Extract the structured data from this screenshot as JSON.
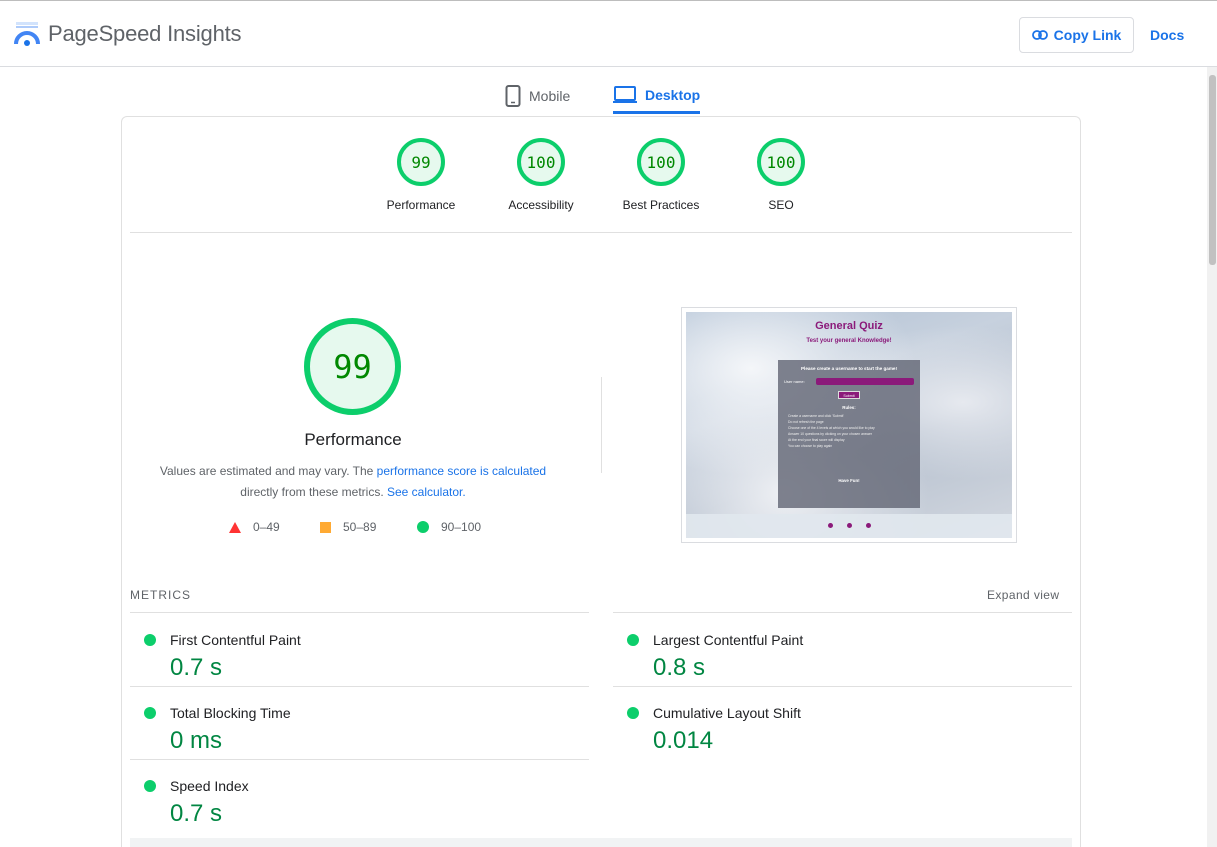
{
  "app": {
    "title": "PageSpeed Insights",
    "copy_link": "Copy Link",
    "docs": "Docs"
  },
  "tabs": {
    "mobile": "Mobile",
    "desktop": "Desktop",
    "active": "Desktop"
  },
  "scores": [
    {
      "label": "Performance",
      "value": "99"
    },
    {
      "label": "Accessibility",
      "value": "100"
    },
    {
      "label": "Best Practices",
      "value": "100"
    },
    {
      "label": "SEO",
      "value": "100"
    }
  ],
  "colors": {
    "good": "#0cce6b",
    "average": "#ffaa33",
    "poor": "#ff3333",
    "accent": "#1a73e8",
    "good_text": "#008800"
  },
  "performance": {
    "score": "99",
    "title": "Performance",
    "desc_text1": "Values are estimated and may vary. The ",
    "desc_link1": "performance score is calculated",
    "desc_text2": " directly from these metrics. ",
    "desc_link2": "See calculator.",
    "legend": [
      {
        "icon": "triangle-icon",
        "range": "0–49"
      },
      {
        "icon": "square-icon",
        "range": "50–89"
      },
      {
        "icon": "circle-icon",
        "range": "90–100"
      }
    ]
  },
  "screenshot": {
    "title": "General Quiz",
    "subtitle": "Test your general Knowledge!",
    "prompt": "Please create a username to start the game!",
    "username_label": "User name:",
    "submit": "Submit",
    "rules_title": "Rules:",
    "rules": [
      "Create a username and click 'Submit'",
      "Do not refresh the page",
      "Choose one of the 4 levels at which you would like to play",
      "Answer 10 questions by clicking on your chosen answer",
      "At the end your final score will display",
      "You can choose to play again"
    ],
    "fun": "Have Fun!"
  },
  "metrics": {
    "heading": "METRICS",
    "expand": "Expand view",
    "items": [
      {
        "name": "First Contentful Paint",
        "value": "0.7 s"
      },
      {
        "name": "Largest Contentful Paint",
        "value": "0.8 s"
      },
      {
        "name": "Total Blocking Time",
        "value": "0 ms"
      },
      {
        "name": "Cumulative Layout Shift",
        "value": "0.014"
      },
      {
        "name": "Speed Index",
        "value": "0.7 s"
      }
    ]
  }
}
